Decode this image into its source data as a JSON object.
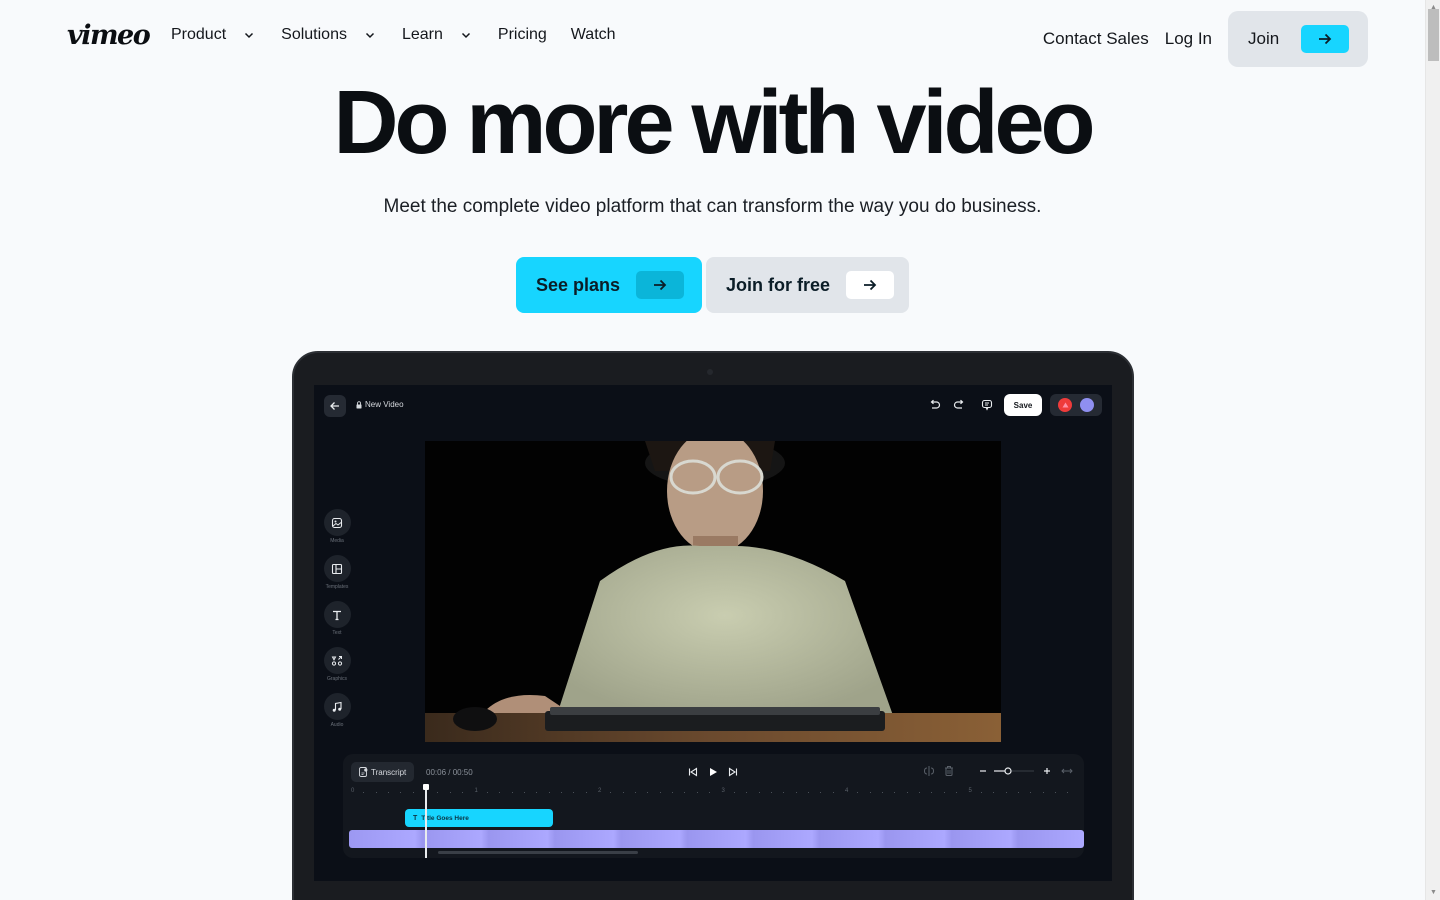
{
  "nav": {
    "logo": "vimeo",
    "items": [
      {
        "label": "Product",
        "has_dropdown": true
      },
      {
        "label": "Solutions",
        "has_dropdown": true
      },
      {
        "label": "Learn",
        "has_dropdown": true
      },
      {
        "label": "Pricing",
        "has_dropdown": false
      },
      {
        "label": "Watch",
        "has_dropdown": false
      }
    ],
    "contact_sales": "Contact Sales",
    "log_in": "Log In",
    "join": "Join"
  },
  "hero": {
    "title": "Do more with video",
    "subtitle": "Meet the complete video platform that can transform the way you do business.",
    "primary_cta": "See plans",
    "secondary_cta": "Join for free"
  },
  "editor": {
    "doc_title": "New Video",
    "save_label": "Save",
    "side_tools": [
      {
        "label": "Media",
        "icon": "image-icon"
      },
      {
        "label": "Templates",
        "icon": "layout-icon"
      },
      {
        "label": "Text",
        "icon": "text-icon"
      },
      {
        "label": "Graphics",
        "icon": "shapes-icon"
      },
      {
        "label": "Audio",
        "icon": "music-icon"
      }
    ],
    "transcript_label": "Transcript",
    "time_display": "00:06 / 00:50",
    "ruler_labels": [
      "0",
      "1",
      "2",
      "3",
      "4",
      "5"
    ],
    "title_clip": "Title Goes Here",
    "playhead_position_seconds": 0.6,
    "zoom_level_fraction": 0.35
  },
  "colors": {
    "accent": "#17d5ff",
    "text": "#0b0e12",
    "background": "#f8fafc",
    "secondary_button": "#e1e5ea",
    "video_track": "#aca8ff",
    "avatar_red": "#ef3b3b",
    "avatar_purple": "#8f8ff0"
  }
}
